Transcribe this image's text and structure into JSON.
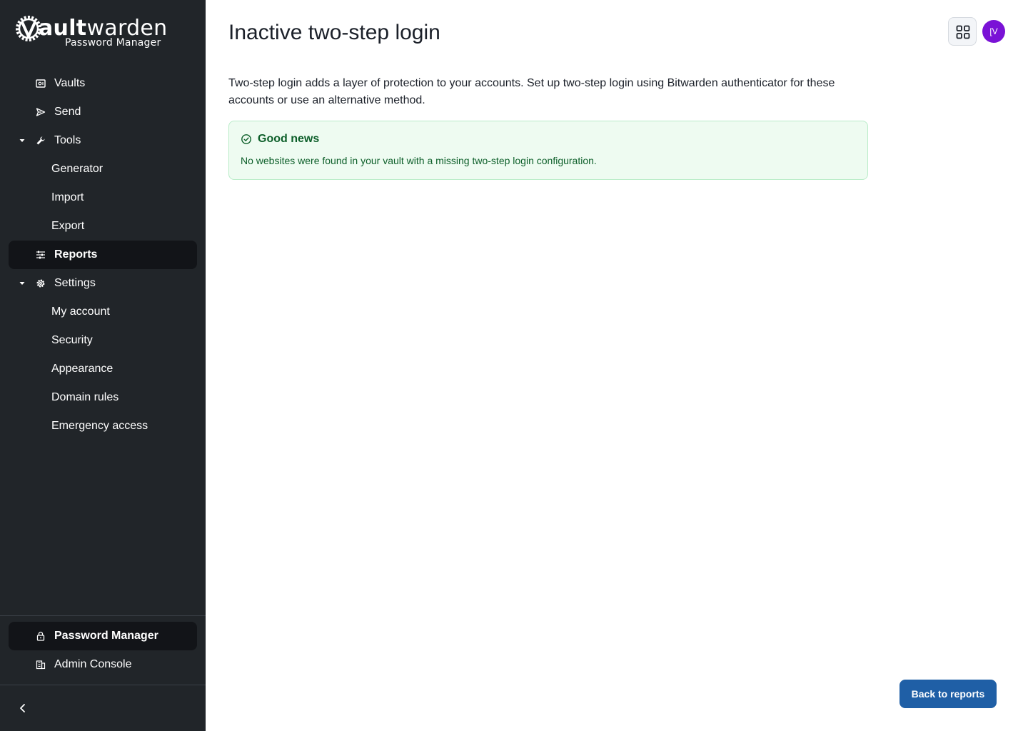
{
  "logo": {
    "brand_bold": "V",
    "brand_rest_bold": "ault",
    "brand_thin": "warden",
    "subtitle": "Password Manager"
  },
  "sidebar": {
    "items": [
      {
        "label": "Vaults",
        "icon": "vault-icon"
      },
      {
        "label": "Send",
        "icon": "send-icon"
      },
      {
        "label": "Tools",
        "icon": "wrench-icon",
        "expanded": true
      },
      {
        "label": "Generator"
      },
      {
        "label": "Import"
      },
      {
        "label": "Export"
      },
      {
        "label": "Reports",
        "icon": "sliders-icon",
        "active": true
      },
      {
        "label": "Settings",
        "icon": "gear-icon",
        "expanded": true
      },
      {
        "label": "My account"
      },
      {
        "label": "Security"
      },
      {
        "label": "Appearance"
      },
      {
        "label": "Domain rules"
      },
      {
        "label": "Emergency access"
      }
    ],
    "footer_items": [
      {
        "label": "Password Manager",
        "icon": "lock-icon",
        "active": true
      },
      {
        "label": "Admin Console",
        "icon": "building-icon"
      }
    ],
    "collapse_icon": "chevron-left-icon"
  },
  "header": {
    "title": "Inactive two-step login",
    "apps_icon": "grid-icon",
    "avatar_initials": "[V"
  },
  "main": {
    "description": "Two-step login adds a layer of protection to your accounts. Set up two-step login using Bitwarden authenticator for these accounts or use an alternative method.",
    "callout": {
      "icon": "check-circle-icon",
      "title": "Good news",
      "text": "No websites were found in your vault with a missing two-step login configuration."
    },
    "back_button": "Back to reports"
  },
  "colors": {
    "sidebar_bg": "#212529",
    "active_bg": "#121418",
    "success_bg": "#eefbf1",
    "success_text": "#0d5f2a",
    "primary_button": "#1f5fa6",
    "avatar": "#7a12d6"
  }
}
